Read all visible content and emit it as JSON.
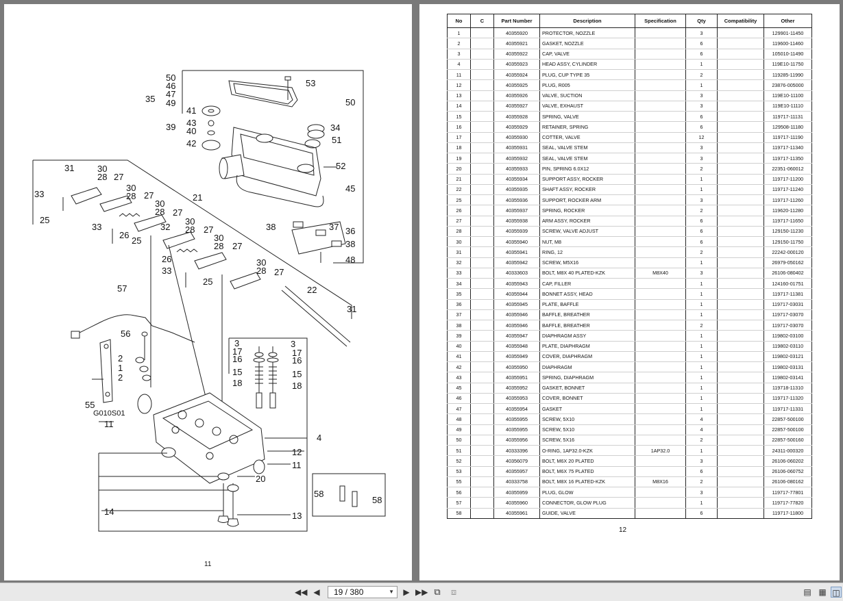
{
  "left_page": {
    "page_number": "11",
    "callouts": [
      "50",
      "46",
      "47",
      "49",
      "35",
      "53",
      "50",
      "41",
      "43",
      "40",
      "39",
      "42",
      "34",
      "51",
      "52",
      "45",
      "31",
      "30",
      "28",
      "27",
      "33",
      "28",
      "30",
      "28",
      "27",
      "25",
      "21",
      "33",
      "26",
      "25",
      "32",
      "30",
      "28",
      "27",
      "26",
      "30",
      "28",
      "27",
      "33",
      "25",
      "38",
      "37",
      "36",
      "38",
      "48",
      "22",
      "31",
      "57",
      "56",
      "2",
      "1",
      "2",
      "55",
      "G010S01",
      "11",
      "3",
      "17",
      "16",
      "15",
      "18",
      "3",
      "17",
      "16",
      "15",
      "18",
      "4",
      "12",
      "11",
      "20",
      "14",
      "13",
      "58",
      "58"
    ]
  },
  "right_page": {
    "page_number": "12",
    "table": {
      "headers": [
        "No",
        "C",
        "Part Number",
        "Description",
        "Specification",
        "Qty",
        "Compatibility",
        "Other"
      ],
      "rows": [
        [
          "1",
          "",
          "40355920",
          "PROTECTOR, NOZZLE",
          "",
          "3",
          "",
          "129901-11450"
        ],
        [
          "2",
          "",
          "40355921",
          "GASKET, NOZZLE",
          "",
          "6",
          "",
          "119600-11460"
        ],
        [
          "3",
          "",
          "40355922",
          "CAP, VALVE",
          "",
          "6",
          "",
          "105010-11490"
        ],
        [
          "4",
          "",
          "40355923",
          "HEAD ASSY, CYLINDER",
          "",
          "1",
          "",
          "119E10-11750"
        ],
        [
          "11",
          "",
          "40355924",
          "PLUG, CUP TYPE 35",
          "",
          "2",
          "",
          "119285-11990"
        ],
        [
          "12",
          "",
          "40355925",
          "PLUG, R005",
          "",
          "1",
          "",
          "23876-005000"
        ],
        [
          "13",
          "",
          "40355926",
          "VALVE, SUCTION",
          "",
          "3",
          "",
          "119E10-11100"
        ],
        [
          "14",
          "",
          "40355927",
          "VALVE, EXHAUST",
          "",
          "3",
          "",
          "119E10-11110"
        ],
        [
          "15",
          "",
          "40355928",
          "SPRING, VALVE",
          "",
          "6",
          "",
          "119717-11131"
        ],
        [
          "16",
          "",
          "40355929",
          "RETAINER, SPRING",
          "",
          "6",
          "",
          "129508-11180"
        ],
        [
          "17",
          "",
          "40355930",
          "COTTER, VALVE",
          "",
          "12",
          "",
          "119717-11190"
        ],
        [
          "18",
          "",
          "40355931",
          "SEAL, VALVE STEM",
          "",
          "3",
          "",
          "119717-11340"
        ],
        [
          "19",
          "",
          "40355932",
          "SEAL, VALVE STEM",
          "",
          "3",
          "",
          "119717-11350"
        ],
        [
          "20",
          "",
          "40355933",
          "PIN, SPRING 6.0X12",
          "",
          "2",
          "",
          "22351-060012"
        ],
        [
          "21",
          "",
          "40355934",
          "SUPPORT ASSY, ROCKER",
          "",
          "1",
          "",
          "119717-11200"
        ],
        [
          "22",
          "",
          "40355935",
          "SHAFT ASSY, ROCKER",
          "",
          "1",
          "",
          "119717-11240"
        ],
        [
          "25",
          "",
          "40355936",
          "SUPPORT, ROCKER ARM",
          "",
          "3",
          "",
          "119717-11260"
        ],
        [
          "26",
          "",
          "40355937",
          "SPRING, ROCKER",
          "",
          "2",
          "",
          "119620-11280"
        ],
        [
          "27",
          "",
          "40355938",
          "ARM ASSY, ROCKER",
          "",
          "6",
          "",
          "119717-11650"
        ],
        [
          "28",
          "",
          "40355939",
          "SCREW, VALVE ADJUST",
          "",
          "6",
          "",
          "129150-11230"
        ],
        [
          "30",
          "",
          "40355940",
          "NUT, M8",
          "",
          "6",
          "",
          "129150-11750"
        ],
        [
          "31",
          "",
          "40355941",
          "RING, 12",
          "",
          "2",
          "",
          "22242-000120"
        ],
        [
          "32",
          "",
          "40355942",
          "SCREW, M5X16",
          "",
          "1",
          "",
          "26979-050162"
        ],
        [
          "33",
          "",
          "40333603",
          "BOLT, M8X 40 PLATED-KZK",
          "M8X40",
          "3",
          "",
          "26106-080402"
        ],
        [
          "34",
          "",
          "40355943",
          "CAP, FILLER",
          "",
          "1",
          "",
          "124160-01751"
        ],
        [
          "35",
          "",
          "40355944",
          "BONNET ASSY, HEAD",
          "",
          "1",
          "",
          "119717-11381"
        ],
        [
          "36",
          "",
          "40355945",
          "PLATE, BAFFLE",
          "",
          "1",
          "",
          "119717-03031"
        ],
        [
          "37",
          "",
          "40355946",
          "BAFFLE, BREATHER",
          "",
          "1",
          "",
          "119717-03070"
        ],
        [
          "38",
          "",
          "40355946",
          "BAFFLE, BREATHER",
          "",
          "2",
          "",
          "119717-03070"
        ],
        [
          "39",
          "",
          "40355947",
          "DIAPHRAGM ASSY",
          "",
          "1",
          "",
          "119802-03100"
        ],
        [
          "40",
          "",
          "40355948",
          "PLATE, DIAPHRAGM",
          "",
          "1",
          "",
          "119802-03110"
        ],
        [
          "41",
          "",
          "40355949",
          "COVER, DIAPHRAGM",
          "",
          "1",
          "",
          "119802-03121"
        ],
        [
          "42",
          "",
          "40355950",
          "DIAPHRAGM",
          "",
          "1",
          "",
          "119802-03131"
        ],
        [
          "43",
          "",
          "40355951",
          "SPRING, DIAPHRAGM",
          "",
          "1",
          "",
          "119802-03141"
        ],
        [
          "45",
          "",
          "40355952",
          "GASKET, BONNET",
          "",
          "1",
          "",
          "119718-11310"
        ],
        [
          "46",
          "",
          "40355953",
          "COVER, BONNET",
          "",
          "1",
          "",
          "119717-11320"
        ],
        [
          "47",
          "",
          "40355954",
          "GASKET",
          "",
          "1",
          "",
          "119717-11331"
        ],
        [
          "48",
          "",
          "40355955",
          "SCREW, 5X10",
          "",
          "4",
          "",
          "22857-500100"
        ],
        [
          "49",
          "",
          "40355955",
          "SCREW, 5X10",
          "",
          "4",
          "",
          "22857-500100"
        ],
        [
          "50",
          "",
          "40355956",
          "SCREW, 5X16",
          "",
          "2",
          "",
          "22857-500160"
        ],
        [
          "51",
          "",
          "40333396",
          "O-RING, 1AP32.0-KZK",
          "1AP32.0",
          "1",
          "",
          "24311-000320"
        ],
        [
          "52",
          "",
          "40356079",
          "BOLT, M6X 20 PLATED",
          "",
          "3",
          "",
          "26106-060202"
        ],
        [
          "53",
          "",
          "40355957",
          "BOLT, M6X 75 PLATED",
          "",
          "6",
          "",
          "26106-060752"
        ],
        [
          "55",
          "",
          "40333758",
          "BOLT, M8X 16 PLATED-KZK",
          "M8X16",
          "2",
          "",
          "26106-080162"
        ],
        [
          "56",
          "",
          "40355959",
          "PLUG, GLOW",
          "",
          "3",
          "",
          "119717-77801"
        ],
        [
          "57",
          "",
          "40355960",
          "CONNECTOR, GLOW PLUG",
          "",
          "1",
          "",
          "119717-77820"
        ],
        [
          "58",
          "",
          "40355961",
          "GUIDE, VALVE",
          "",
          "6",
          "",
          "119717-11800"
        ]
      ]
    }
  },
  "toolbar": {
    "page_indicator": "19 / 380",
    "icons": [
      "first-page-icon",
      "prev-page-icon",
      "next-page-icon",
      "last-page-icon",
      "rotate-icon",
      "fit-icon",
      "single-page-icon",
      "continuous-icon",
      "two-page-icon"
    ]
  }
}
